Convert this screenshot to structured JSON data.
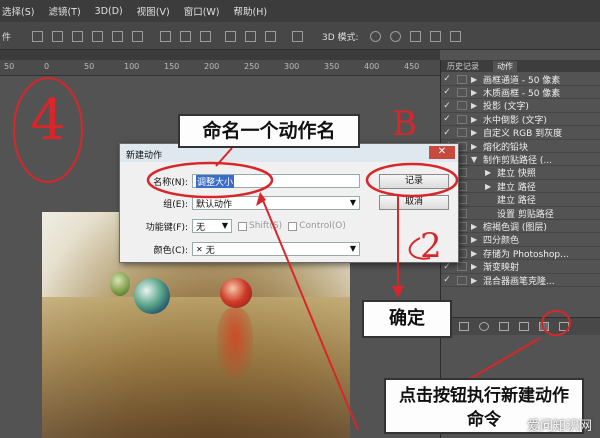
{
  "menu": [
    "选择(S)",
    "滤镜(T)",
    "3D(D)",
    "视图(V)",
    "窗口(W)",
    "帮助(H)"
  ],
  "optbar": {
    "label_left": "件",
    "mode_label": "3D 模式:"
  },
  "ruler": [
    "50",
    "0",
    "50",
    "100",
    "150",
    "200",
    "250",
    "300",
    "350",
    "400",
    "450"
  ],
  "panel": {
    "tabs": [
      "历史记录",
      "动作"
    ],
    "actions": [
      {
        "check": "✓",
        "tri": "▶",
        "label": "画框通道 - 50 像素"
      },
      {
        "check": "✓",
        "tri": "▶",
        "label": "木质画框 - 50 像素"
      },
      {
        "check": "✓",
        "tri": "▶",
        "label": "投影 (文字)"
      },
      {
        "check": "✓",
        "tri": "▶",
        "label": "水中倒影 (文字)"
      },
      {
        "check": "✓",
        "tri": "▶",
        "label": "自定义 RGB 到灰度"
      },
      {
        "check": "✓",
        "tri": "▶",
        "label": "熔化的铅块"
      },
      {
        "check": "✓",
        "tri": "▼",
        "label": "制作剪贴路径 (..."
      },
      {
        "check": "✓",
        "tri": "▶",
        "label": "建立 快照"
      },
      {
        "check": "✓",
        "tri": "▶",
        "label": "建立 路径"
      },
      {
        "check": "✓",
        "tri": "",
        "label": "建立 路径"
      },
      {
        "check": "✓",
        "tri": "",
        "label": "设置 剪贴路径"
      },
      {
        "check": "✓",
        "tri": "▶",
        "label": "棕褐色调 (图层)"
      },
      {
        "check": "✓",
        "tri": "▶",
        "label": "四分颜色"
      },
      {
        "check": "✓",
        "tri": "▶",
        "label": "存储为 Photoshop..."
      },
      {
        "check": "✓",
        "tri": "▶",
        "label": "渐变映射"
      },
      {
        "check": "✓",
        "tri": "▶",
        "label": "混合器画笔克隆..."
      }
    ]
  },
  "dialog": {
    "title": "新建动作",
    "close": "✕",
    "name_label": "名称(N):",
    "name_value": "调整大小",
    "group_label": "组(E):",
    "group_value": "默认动作",
    "fkey_label": "功能键(F):",
    "fkey_value": "无",
    "shift_label": "Shift(S)",
    "control_label": "Control(O)",
    "color_label": "颜色(C):",
    "color_value": "无",
    "record_button": "记录",
    "cancel_button": "取消"
  },
  "annotations": {
    "callout_top": "命名一个动作名",
    "callout_confirm": "确定",
    "callout_bottom": "点击按钮执行新建动作命令",
    "num4": "4",
    "letterB": "B",
    "num2": "2",
    "watermark": "爱问知识网"
  },
  "colors": {
    "annotation_red": "#d8262a",
    "dialog_bg": "#f0f0f0",
    "ps_dark": "#535353"
  }
}
